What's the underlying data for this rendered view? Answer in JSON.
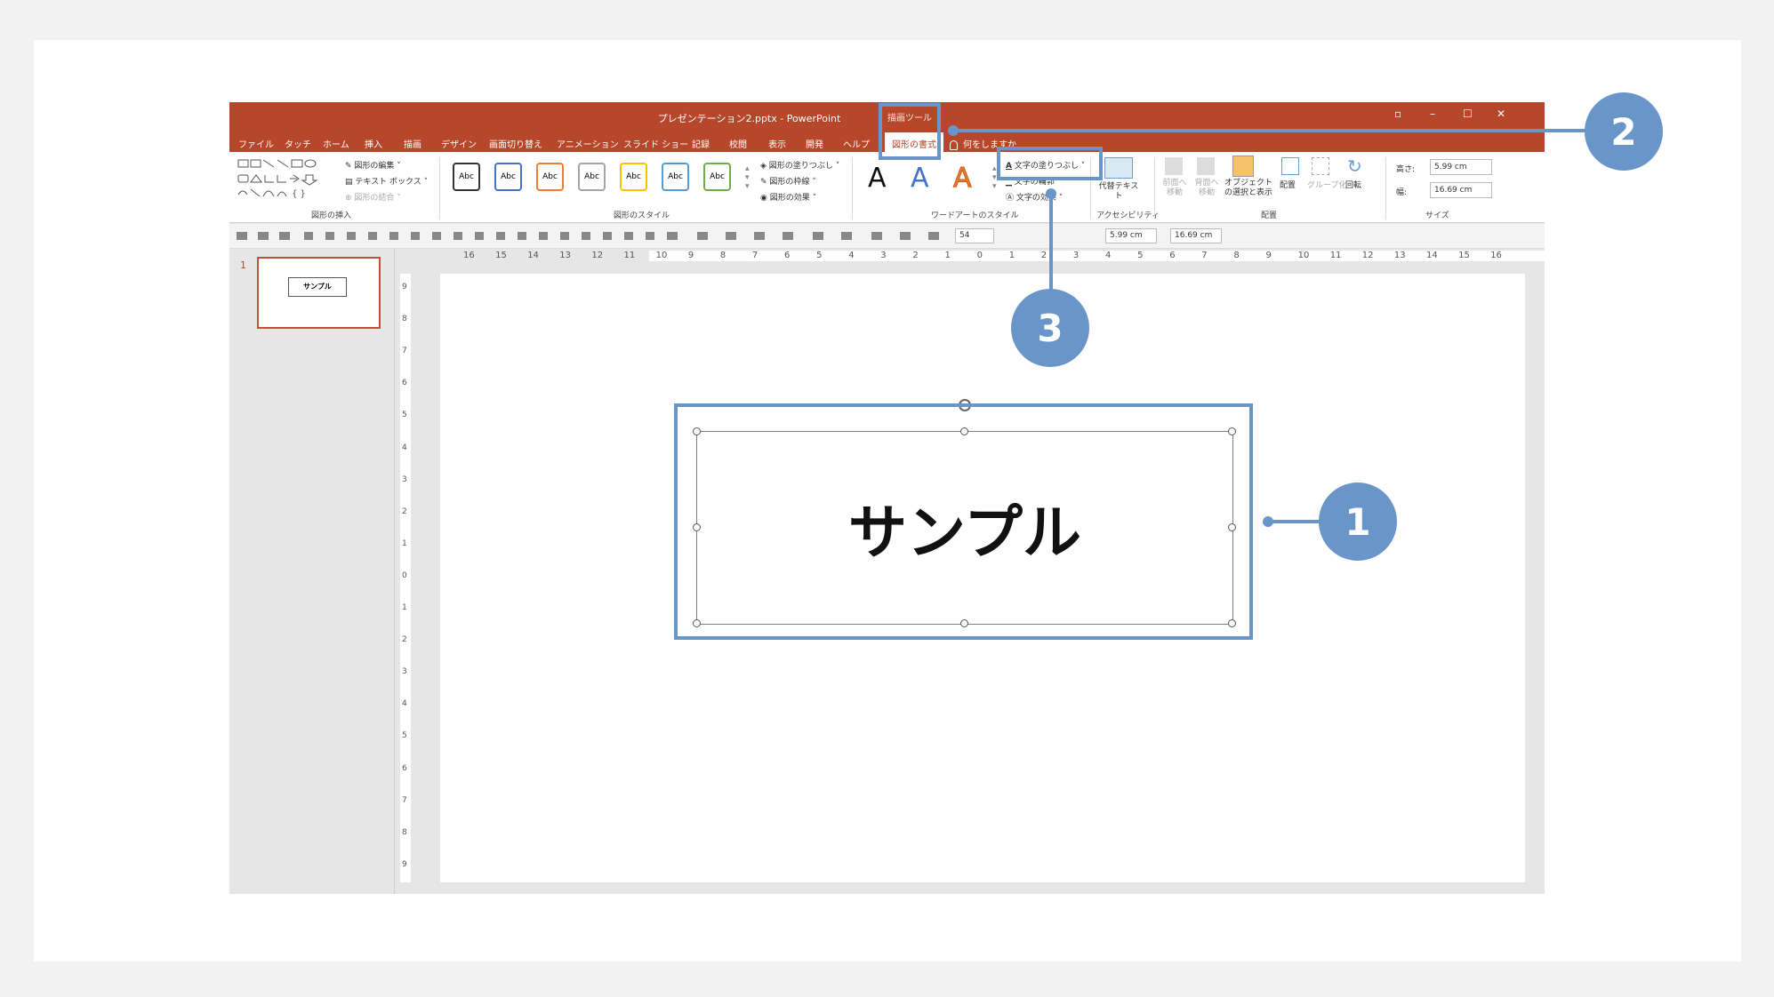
{
  "window": {
    "title": "プレゼンテーション2.pptx - PowerPoint",
    "context_label": "描画ツール"
  },
  "tabs": [
    {
      "label": "ファイル"
    },
    {
      "label": "タッチ"
    },
    {
      "label": "ホーム"
    },
    {
      "label": "挿入"
    },
    {
      "label": "描画"
    },
    {
      "label": "デザイン"
    },
    {
      "label": "画面切り替え"
    },
    {
      "label": "アニメーション"
    },
    {
      "label": "スライド ショー"
    },
    {
      "label": "記録"
    },
    {
      "label": "校閲"
    },
    {
      "label": "表示"
    },
    {
      "label": "開発"
    },
    {
      "label": "ヘルプ"
    },
    {
      "label": "図形の書式"
    }
  ],
  "tell_me": "何をしますか",
  "ribbon": {
    "insert_shapes": {
      "label": "図形の挿入",
      "edit_shape": "図形の編集",
      "text_box": "テキスト ボックス",
      "merge_shapes": "図形の結合"
    },
    "shape_styles": {
      "label": "図形のスタイル",
      "preset_text": "Abc",
      "fill": "図形の塗りつぶし",
      "outline": "図形の枠線",
      "effects": "図形の効果"
    },
    "wordart": {
      "label": "ワードアートのスタイル",
      "letter": "A",
      "text_fill": "文字の塗りつぶし",
      "text_outline": "文字の輪郭",
      "text_effects": "文字の効果"
    },
    "accessibility": {
      "label": "アクセシビリティ",
      "alt_text": "代替テキスト"
    },
    "arrange": {
      "label": "配置",
      "bring_forward": "前面へ移動",
      "send_backward": "背面へ移動",
      "selection_pane": "オブジェクトの選択と表示",
      "align": "配置",
      "group": "グループ化",
      "rotate": "回転"
    },
    "size": {
      "label": "サイズ",
      "height_label": "高さ:",
      "height_value": "5.99 cm",
      "width_label": "幅:",
      "width_value": "16.69 cm"
    }
  },
  "quick_toolbar": {
    "font_size": "54",
    "height_value": "5.99 cm",
    "width_value": "16.69 cm"
  },
  "ruler_h": [
    "16",
    "15",
    "14",
    "13",
    "12",
    "11",
    "10",
    "9",
    "8",
    "7",
    "6",
    "5",
    "4",
    "3",
    "2",
    "1",
    "0",
    "1",
    "2",
    "3",
    "4",
    "5",
    "6",
    "7",
    "8",
    "9",
    "10",
    "11",
    "12",
    "13",
    "14",
    "15",
    "16"
  ],
  "ruler_v": [
    "9",
    "8",
    "7",
    "6",
    "5",
    "4",
    "3",
    "2",
    "1",
    "0",
    "1",
    "2",
    "3",
    "4",
    "5",
    "6",
    "7",
    "8",
    "9"
  ],
  "slides": [
    {
      "number": "1",
      "text": "サンプル"
    }
  ],
  "shape_text": "サンプル",
  "callouts": [
    "1",
    "2",
    "3"
  ],
  "colors": {
    "accent": "#b7472a",
    "annotation": "#6a95c9"
  }
}
